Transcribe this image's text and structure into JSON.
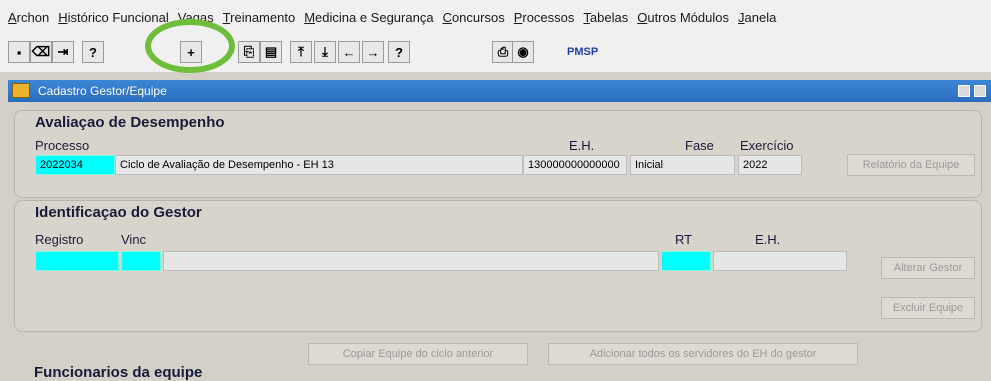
{
  "menu": [
    "Archon",
    "Histórico Funcional",
    "Vagas",
    "Treinamento",
    "Medicina e Segurança",
    "Concursos",
    "Processos",
    "Tabelas",
    "Outros Módulos",
    "Janela"
  ],
  "toolbar": {
    "buttons": [
      {
        "name": "save-icon",
        "glyph": "▪"
      },
      {
        "name": "delete-icon",
        "glyph": "⌫"
      },
      {
        "name": "exit-icon",
        "glyph": "⇥"
      },
      {
        "name": "query-icon",
        "glyph": "?"
      },
      {
        "name": "new-record-icon",
        "glyph": "+"
      },
      {
        "name": "copy-icon",
        "glyph": "⎘"
      },
      {
        "name": "clipboard-icon",
        "glyph": "▤"
      },
      {
        "name": "first-record-icon",
        "glyph": "⤒"
      },
      {
        "name": "last-record-icon",
        "glyph": "⤓"
      },
      {
        "name": "previous-icon",
        "glyph": "←"
      },
      {
        "name": "next-icon",
        "glyph": "→"
      },
      {
        "name": "help-icon",
        "glyph": "?"
      },
      {
        "name": "print-icon",
        "glyph": "⎙"
      },
      {
        "name": "pmsp-icon",
        "glyph": "◉"
      }
    ],
    "pmsp_label": "PMSP"
  },
  "window": {
    "title": "Cadastro Gestor/Equipe"
  },
  "avaliacao": {
    "heading": "Avaliaçao de Desempenho",
    "labels": {
      "processo": "Processo",
      "eh": "E.H.",
      "fase": "Fase",
      "exercicio": "Exercício"
    },
    "processo_code": "2022034",
    "processo_desc": "Ciclo de Avaliação de Desempenho - EH 13",
    "eh_value": "130000000000000",
    "fase_value": "Inicial",
    "exercicio_value": "2022",
    "relatorio_button": "Relatório da Equipe"
  },
  "gestor": {
    "heading": "Identificaçao do Gestor",
    "labels": {
      "registro": "Registro",
      "vinc": "Vinc",
      "rt": "RT",
      "eh": "E.H."
    },
    "registro": "",
    "vinc": "",
    "nome": "",
    "rt": "",
    "eh": "",
    "alterar_button": "Alterar Gestor",
    "excluir_button": "Excluir Equipe"
  },
  "actions": {
    "copiar_button": "Copiar Equipe do ciclo anterior",
    "adicionar_button": "Adicionar todos os servidores do EH do gestor"
  },
  "funcionarios": {
    "heading": "Funcionarios da equipe"
  }
}
